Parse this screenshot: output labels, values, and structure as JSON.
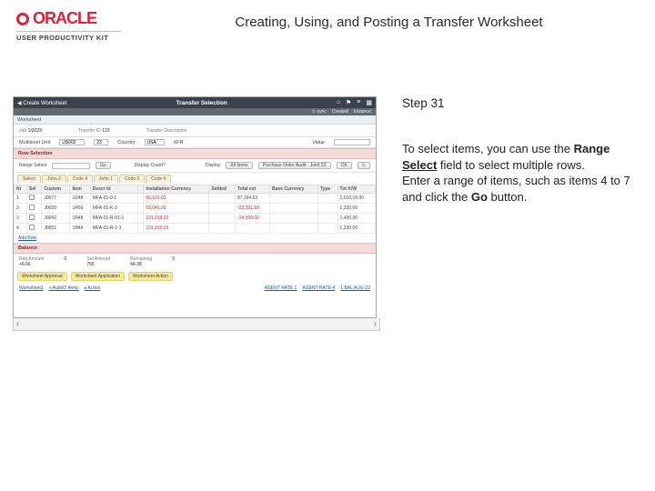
{
  "header": {
    "brand": "ORACLE",
    "subbrand": "USER PRODUCTIVITY KIT",
    "title": "Creating, Using, and Posting a Transfer Worksheet"
  },
  "right": {
    "step": "Step 31",
    "p1_a": "To select items, you can use the ",
    "p1_b": "Range ",
    "p1_c": "Select",
    "p1_d": " field to select multiple rows. ",
    "p2_a": "Enter a range of items, such as items 4 ",
    "p2_b": "to 7 and click the ",
    "p2_c": "Go",
    "p2_d": " button. "
  },
  "app": {
    "topbar": {
      "back": "◀ Create Worksheet",
      "title": "Transfer Selection",
      "icons": {
        "home": "⌂",
        "flag": "⚑",
        "menu": "≡",
        "grid": "▦"
      }
    },
    "subbar": {
      "left": "",
      "refs": "↻ sync",
      "created": "Created",
      "instance": "Instance:"
    },
    "breadcrumb": {
      "item": "Worksheet"
    },
    "inforow": {
      "job_l": "Job",
      "job_v": "1/2023",
      "tid_l": "Transfer ID",
      "tid_v": "123",
      "desc_l": "Transfer Description",
      "desc_v": ""
    },
    "inforow2": {
      "mu_l": "Multilevel Unit",
      "mu_v": "US002",
      "mu2": "23",
      "ctry_l": "Country",
      "ctry_v": "USA",
      "xfer": "XFR",
      "fiv_l": "Value",
      "fiv_v": ""
    },
    "rowsel": {
      "title": "Row Selection",
      "range_l": "Range Select",
      "go": "Go",
      "disp_l": "Display Count?",
      "disp2": "Display",
      "allitems": "All Items",
      "dropdown": "Purchase Order Audit - Joint 23"
    },
    "tabstrip": [
      "Select",
      "John 2",
      "Code 4",
      "John 1",
      "Code 3",
      "Code 4"
    ],
    "grid": {
      "cols": [
        "Nr",
        "Sel",
        "Custom",
        "Item",
        "Descr Id",
        "",
        "Installation Currency",
        "Settled",
        "Total ext",
        "Base Currency",
        "Type",
        "Tot K/W"
      ],
      "rows": [
        {
          "nr": "1",
          "custom": "J0077",
          "item": "U248",
          "desc": "MFA-01-0-1",
          "inst": "03,101.03",
          "settled": "",
          "tot": "97,194.53",
          "type": "",
          "totkw": "1,010,18.00"
        },
        {
          "nr": "2",
          "custom": "J0039",
          "item": "U459",
          "desc": "MFA-01-K-3",
          "inst": "03,041.93",
          "settled": "",
          "tot": "-02,391.93",
          "type": "",
          "totkw": "1,220.00"
        },
        {
          "nr": "3",
          "custom": "J0042",
          "item": "U948",
          "desc": "MFA-01-R-01-1",
          "inst": "101,019.02",
          "settled": "",
          "tot": "-14,399.02",
          "type": "",
          "totkw": "1,430.00"
        },
        {
          "nr": "4",
          "custom": "J0051",
          "item": "U949",
          "desc": "MFA-01-R-1-1",
          "inst": "101,010.03",
          "settled": "",
          "tot": "",
          "type": "",
          "totkw": "1,330.00"
        }
      ]
    },
    "addrow": "Add Row",
    "totalsTitle": "Balance",
    "totals": {
      "rea_l": "Req Amount",
      "rea_v": "+6.66",
      "items_l": "",
      "items_v": "0",
      "set_l": "Set Amount",
      "set_v": "765",
      "rem_l": "Remaining",
      "rem_v": "44.38",
      "cnt_l": "",
      "cnt_v": "3"
    },
    "yellow": [
      "Worksheet Approval",
      "Worksheet Application",
      "Worksheet Action"
    ],
    "links": [
      "Worksheet1",
      "+ Audit/3 Items",
      "▸ Action"
    ],
    "footer1": "AGENT RATE 1",
    "footer2": "AGENT-RATE-4",
    "footer3": "1 BAL AUG-23"
  },
  "scroll": {
    "left": "‹",
    "right": "›"
  }
}
